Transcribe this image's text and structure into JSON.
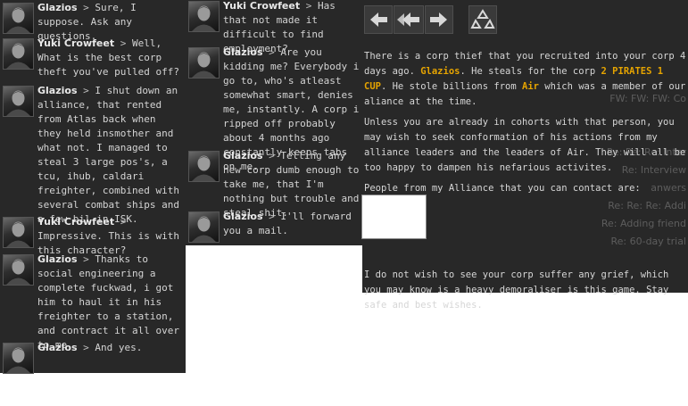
{
  "chat_left": [
    {
      "name": "Glazios",
      "sep": " > ",
      "text": "Sure, I suppose. Ask any questions."
    },
    {
      "name": "Yuki Crowfeet",
      "sep": " > ",
      "text": "Well, What is the best corp theft you've pulled off?"
    },
    {
      "name": "Glazios",
      "sep": " > ",
      "text": "I shut down an alliance, that rented from Atlas back when they held insmother and what not. I managed to steal 3 large pos's, a tcu, ihub, caldari freighter, combined with several combat ships and a few bil in ISK."
    },
    {
      "name": "Yuki Crowfeet",
      "sep": " > ",
      "text": "Impressive. This is with this character?"
    },
    {
      "name": "Glazios",
      "sep": " > ",
      "text": "Thanks to social engineering a complete fuckwad, i got him to haul it in his freighter to a station, and contract it all over to me."
    },
    {
      "name": "Glazios",
      "sep": " > ",
      "text": "And yes."
    }
  ],
  "chat_mid": [
    {
      "name": "Yuki Crowfeet",
      "sep": " > ",
      "text": "Has that not made it difficult to find employment?"
    },
    {
      "name": "Glazios",
      "sep": " > ",
      "text": "Are you kidding me? Everybody i go to, who's atleast somewhat smart, denies me, instantly. A corp i ripped off probably about 4 months ago constantly keeps tabs on me."
    },
    {
      "name": "Glazios",
      "sep": " > ",
      "text": "Telling any new corp dumb enough to take me, that I'm nothing but trouble and steal shit."
    },
    {
      "name": "Glazios",
      "sep": " > ",
      "text": "I'll forward you a mail."
    }
  ],
  "mail": {
    "p1_a": "There is a corp thief that you recruited into your corp 4 days ago. ",
    "p1_name": "Glazios",
    "p1_b": ". He steals for the corp ",
    "p1_corp": "2 PIRATES 1 CUP",
    "p1_c": ". He stole billions from ",
    "p1_alliance": "Air",
    "p1_d": " which was a member of our aliance at the time.",
    "p2": "Unless you are already in cohorts with that person, you may wish to seek conformation of his actions from my alliance leaders and the leaders of Air. They will all be too happy to dampen his nefarious activites.",
    "p3": "People from my Alliance that you can contact are:",
    "p4": "I do not wish to see your corp suffer any grief, which you may know is a heavy demoraliser is this game. Stay safe and best wishes."
  },
  "mail_list_ghost": [
    "FW: FW: FW: Co",
    "Re: Re: Re: Inter",
    "Re: Interview",
    "anwers",
    "Re: Re: Re: Addi",
    "Re: Adding friend",
    "Re: 60-day trial"
  ],
  "toolbar": {
    "reply_icon": "reply-icon",
    "reply_all_icon": "reply-all-icon",
    "forward_icon": "forward-icon",
    "recycle_icon": "recycle-icon"
  },
  "colors": {
    "panel_bg": "#282828",
    "highlight": "#e6a400"
  }
}
